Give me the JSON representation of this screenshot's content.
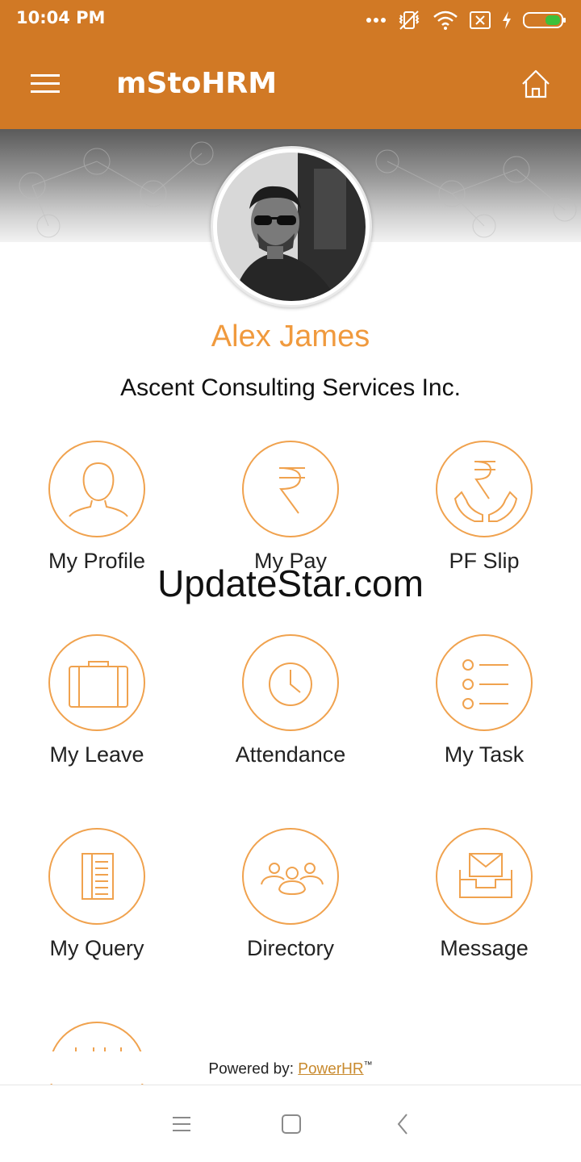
{
  "status_bar": {
    "time": "10:04 PM",
    "icons": [
      "more-dots-icon",
      "vibrate-icon",
      "wifi-icon",
      "sim-x-icon",
      "charging-icon",
      "battery-icon"
    ]
  },
  "app_bar": {
    "title": "mStoHRM",
    "background": "#d17925"
  },
  "profile": {
    "name": "Alex James",
    "company": "Ascent Consulting Services Inc.",
    "name_color": "#f09a3e"
  },
  "menu": [
    {
      "label": "My Profile",
      "icon": "user-icon"
    },
    {
      "label": "My Pay",
      "icon": "rupee-icon"
    },
    {
      "label": "PF Slip",
      "icon": "rupee-hands-icon"
    },
    {
      "label": "My Leave",
      "icon": "briefcase-icon"
    },
    {
      "label": "Attendance",
      "icon": "clock-icon"
    },
    {
      "label": "My Task",
      "icon": "task-list-icon"
    },
    {
      "label": "My Query",
      "icon": "document-list-icon"
    },
    {
      "label": "Directory",
      "icon": "people-group-icon"
    },
    {
      "label": "Message",
      "icon": "inbox-mail-icon"
    }
  ],
  "watermark": "UpdateStar.com",
  "footer": {
    "prefix": "Powered by: ",
    "link": "PowerHR",
    "tm": "™"
  },
  "accent": "#f0a24e"
}
